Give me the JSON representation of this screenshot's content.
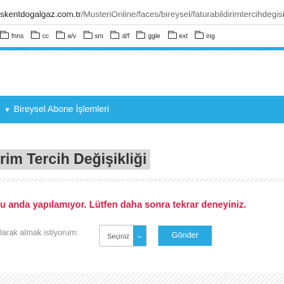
{
  "browser": {
    "url_host": "skentdogalgaz.com.tr",
    "url_path": "/MusteriOnline/faces/bireysel/faturabildirimtercihdegisikli",
    "bookmarks": [
      {
        "label": "fnns",
        "icon": "folder-icon"
      },
      {
        "label": "cc",
        "icon": "folder-icon"
      },
      {
        "label": "a/v",
        "icon": "folder-icon"
      },
      {
        "label": "sm",
        "icon": "folder-icon"
      },
      {
        "label": "d/f",
        "icon": "folder-icon"
      },
      {
        "label": "ggle",
        "icon": "folder-icon"
      },
      {
        "label": "ext",
        "icon": "folder-icon"
      },
      {
        "label": "ing",
        "icon": "folder-icon"
      }
    ]
  },
  "nav": {
    "menu_label": "Bireysel Abone İşlemleri",
    "caret_icon": "caret-down-icon"
  },
  "page": {
    "title": "rim Tercih Değişikliği",
    "error_message": "u anda yapılamıyor. Lütfen daha sonra tekrar deneyiniz."
  },
  "form": {
    "label": "larak almak istiyorum:",
    "select_value": "Seçiniz",
    "select_icon": "chevron-down-icon",
    "submit_label": "Gönder"
  },
  "colors": {
    "accent": "#29abe2",
    "error": "#d11f46",
    "title_bg": "#d9d9d9"
  }
}
